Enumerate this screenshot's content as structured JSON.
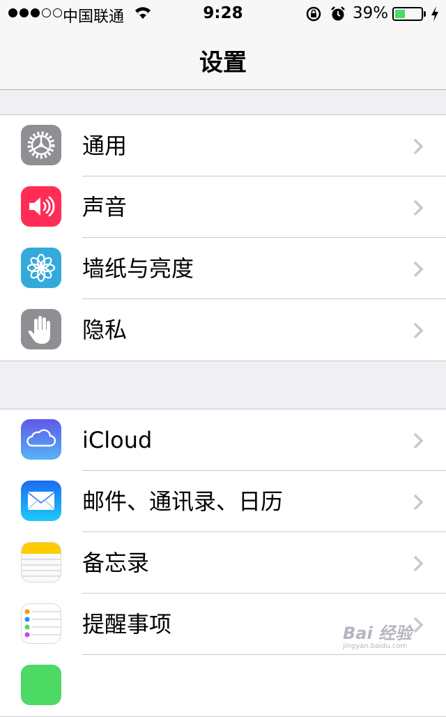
{
  "status_bar": {
    "carrier": "中国联通",
    "time": "9:28",
    "battery_percent_text": "39%",
    "battery_level": 0.39,
    "battery_color": "#4cd964"
  },
  "nav": {
    "title": "设置"
  },
  "groups": [
    {
      "items": [
        {
          "label": "通用",
          "icon": "gear-icon",
          "color": "#8e8e93"
        },
        {
          "label": "声音",
          "icon": "speaker-icon",
          "color": "#ff2d55"
        },
        {
          "label": "墙纸与亮度",
          "icon": "flower-icon",
          "color": "#34aadc"
        },
        {
          "label": "隐私",
          "icon": "hand-icon",
          "color": "#8e8e93"
        }
      ]
    },
    {
      "items": [
        {
          "label": "iCloud",
          "icon": "cloud-icon",
          "color": "#5a6df0"
        },
        {
          "label": "邮件、通讯录、日历",
          "icon": "mail-icon",
          "color": "#1e90ff"
        },
        {
          "label": "备忘录",
          "icon": "notes-icon",
          "color": "#ffcc00"
        },
        {
          "label": "提醒事项",
          "icon": "reminders-icon",
          "color": "#ffffff"
        },
        {
          "label": "",
          "icon": "app-icon",
          "color": "#4cd964"
        }
      ]
    }
  ],
  "watermark": {
    "text": "Bai 经验",
    "sub": "jingyan.baidu.com"
  }
}
